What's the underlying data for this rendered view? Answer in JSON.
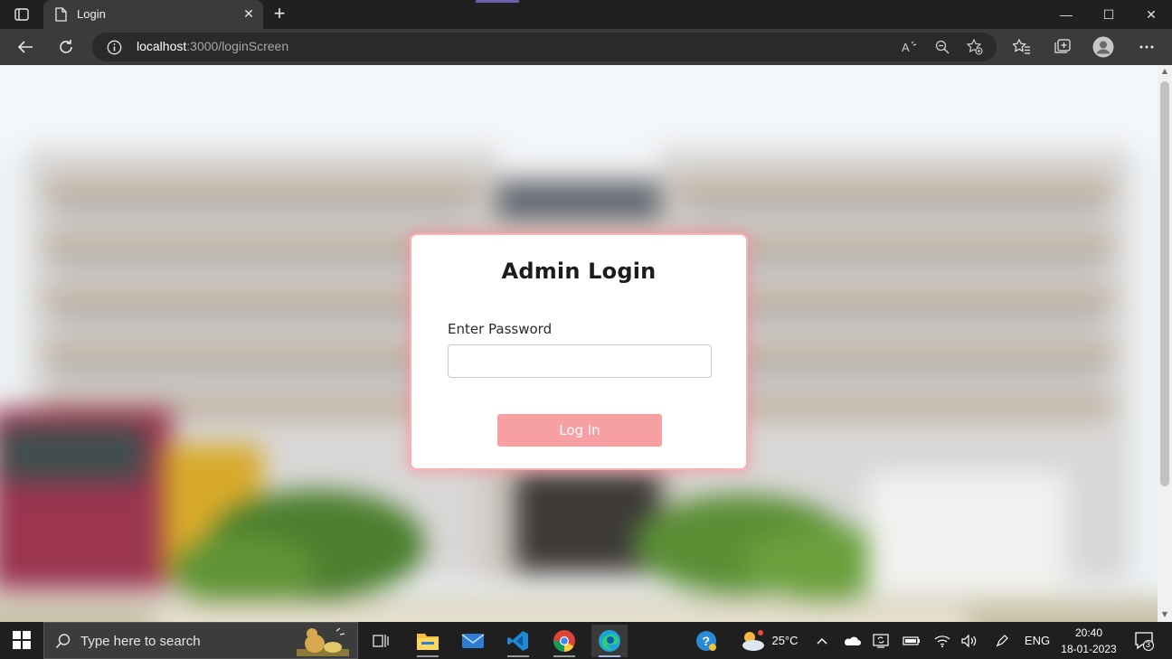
{
  "browser": {
    "tab": {
      "title": "Login",
      "close_glyph": "✕"
    },
    "new_tab_glyph": "+",
    "window_controls": {
      "minimize": "—",
      "maximize": "☐",
      "close": "✕"
    },
    "address": {
      "host": "localhost",
      "path": ":3000/loginScreen"
    }
  },
  "page": {
    "title": "Admin Login",
    "password_label": "Enter Password",
    "password_value": "",
    "login_button": "Log In",
    "accent_color": "#f7a0a4"
  },
  "taskbar": {
    "search_placeholder": "Type here to search",
    "weather": "25°C",
    "language": "ENG",
    "time": "20:40",
    "date": "18-01-2023",
    "notification_count": "3"
  }
}
